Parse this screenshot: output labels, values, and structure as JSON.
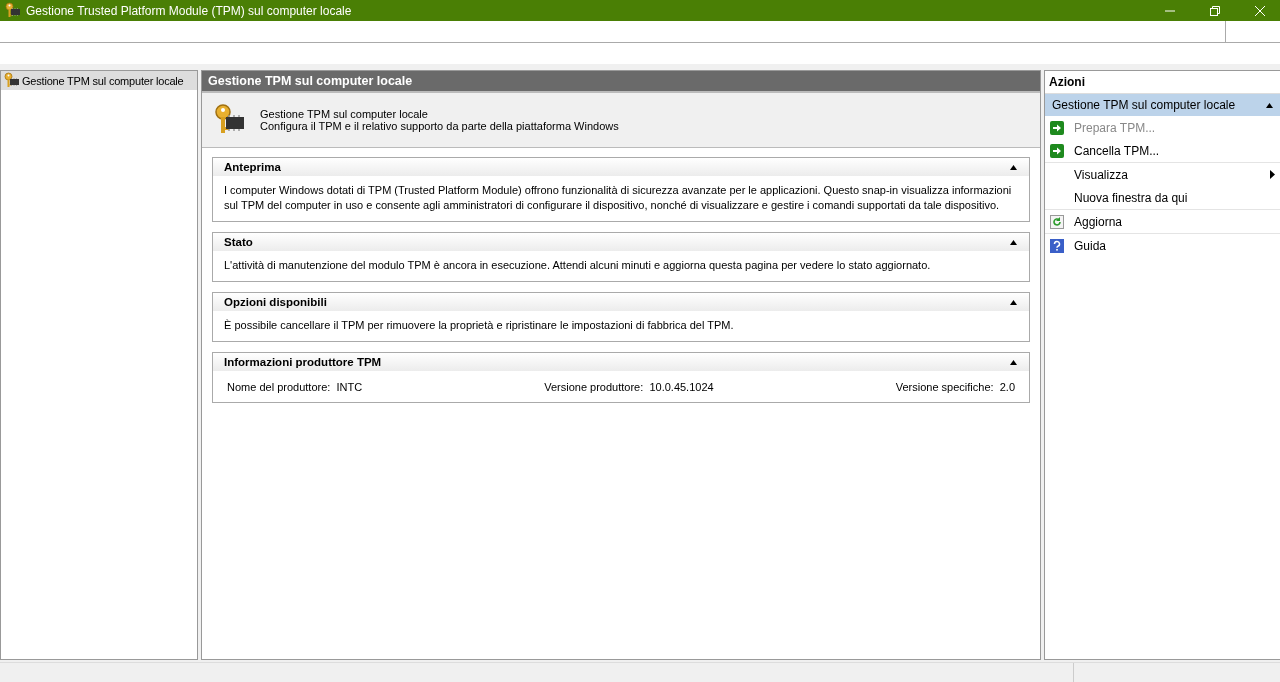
{
  "window": {
    "title": "Gestione Trusted Platform Module (TPM) sul computer locale"
  },
  "tree": {
    "items": [
      {
        "label": "Gestione TPM sul computer locale",
        "selected": true
      }
    ]
  },
  "main": {
    "header": "Gestione TPM sul computer locale",
    "intro": {
      "title": "Gestione TPM sul computer locale",
      "subtitle": "Configura il TPM e il relativo supporto da parte della piattaforma Windows"
    },
    "sections": [
      {
        "kind": "text",
        "title": "Anteprima",
        "expanded": true,
        "text": "I computer Windows dotati di TPM (Trusted Platform Module) offrono funzionalità di sicurezza avanzate per le applicazioni. Questo snap-in visualizza informazioni sul TPM del computer in uso e consente agli amministratori di configurare il dispositivo, nonché di visualizzare e gestire i comandi supportati da tale dispositivo."
      },
      {
        "kind": "text",
        "title": "Stato",
        "expanded": true,
        "text": "L'attività di manutenzione del modulo TPM è ancora in esecuzione. Attendi alcuni minuti e aggiorna questa pagina per vedere lo stato aggiornato."
      },
      {
        "kind": "text",
        "title": "Opzioni disponibili",
        "expanded": true,
        "text": "È possibile cancellare il TPM per rimuovere la proprietà e ripristinare le impostazioni di fabbrica del TPM."
      },
      {
        "kind": "fields",
        "title": "Informazioni produttore TPM",
        "expanded": true,
        "fields": [
          {
            "label": "Nome del produttore:",
            "value": "INTC"
          },
          {
            "label": "Versione produttore:",
            "value": "10.0.45.1024"
          },
          {
            "label": "Versione specifiche:",
            "value": "2.0"
          }
        ]
      }
    ]
  },
  "actions": {
    "title": "Azioni",
    "group": {
      "label": "Gestione TPM sul computer locale",
      "expanded": true
    },
    "items": [
      {
        "kind": "arrow",
        "label": "Prepara TPM...",
        "disabled": true,
        "submenu": false,
        "divider_after": false
      },
      {
        "kind": "arrow",
        "label": "Cancella TPM...",
        "disabled": false,
        "submenu": false,
        "divider_after": true
      },
      {
        "kind": "none",
        "label": "Visualizza",
        "disabled": false,
        "submenu": true,
        "divider_after": false
      },
      {
        "kind": "none",
        "label": "Nuova finestra da qui",
        "disabled": false,
        "submenu": false,
        "divider_after": true
      },
      {
        "kind": "refresh",
        "label": "Aggiorna",
        "disabled": false,
        "submenu": false,
        "divider_after": true
      },
      {
        "kind": "help",
        "label": "Guida",
        "disabled": false,
        "submenu": false,
        "divider_after": false
      }
    ]
  }
}
